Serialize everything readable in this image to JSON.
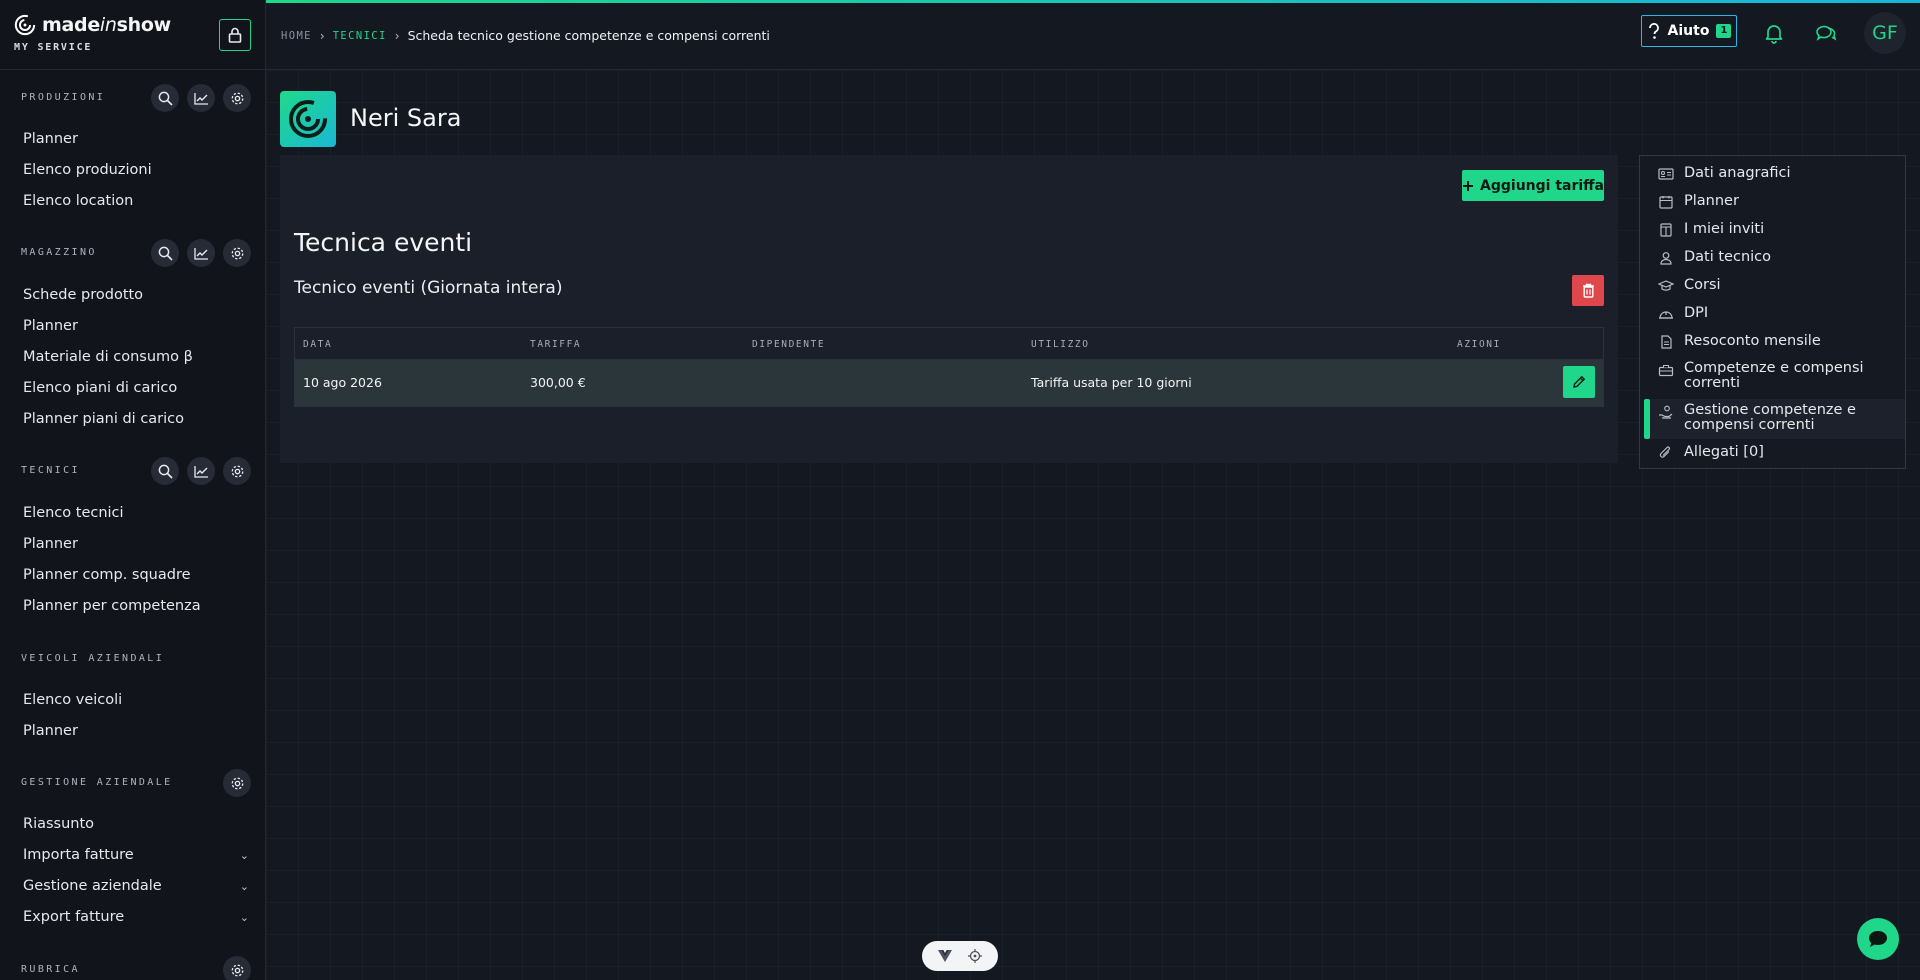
{
  "brand": {
    "name_main": "made",
    "name_italic": "in",
    "name_end": "show",
    "subtitle": "MY SERVICE"
  },
  "sidebar": {
    "sections": [
      {
        "title": "PRODUZIONI",
        "items": [
          "Planner",
          "Elenco produzioni",
          "Elenco location"
        ]
      },
      {
        "title": "MAGAZZINO",
        "items": [
          "Schede prodotto",
          "Planner",
          "Materiale di consumo β",
          "Elenco piani di carico",
          "Planner piani di carico"
        ]
      },
      {
        "title": "TECNICI",
        "items": [
          "Elenco tecnici",
          "Planner",
          "Planner comp. squadre",
          "Planner per competenza"
        ]
      },
      {
        "title": "VEICOLI AZIENDALI",
        "items": [
          "Elenco veicoli",
          "Planner"
        ]
      },
      {
        "title": "GESTIONE AZIENDALE",
        "items": [
          "Riassunto",
          "Importa fatture",
          "Gestione aziendale",
          "Export fatture"
        ]
      },
      {
        "title": "RUBRICA"
      }
    ]
  },
  "breadcrumb": {
    "home": "HOME",
    "section": "TECNICI",
    "current": "Scheda tecnico gestione competenze e compensi correnti"
  },
  "header": {
    "help_label": "Aiuto",
    "help_count": "1",
    "avatar_initials": "GF"
  },
  "profile": {
    "name": "Neri Sara"
  },
  "main": {
    "add_button": "Aggiungi tariffa",
    "section_title": "Tecnica eventi",
    "subsection_title": "Tecnico eventi (Giornata intera)",
    "table": {
      "headers": [
        "DATA",
        "TARIFFA",
        "DIPENDENTE",
        "UTILIZZO",
        "AZIONI"
      ],
      "rows": [
        {
          "data": "10 ago 2026",
          "tariffa": "300,00 €",
          "dipendente": "",
          "utilizzo": "Tariffa usata per 10 giorni"
        }
      ]
    }
  },
  "right_menu": {
    "items": [
      {
        "label": "Dati anagrafici",
        "icon": "id-card-icon"
      },
      {
        "label": "Planner",
        "icon": "calendar-icon"
      },
      {
        "label": "I miei inviti",
        "icon": "invite-icon"
      },
      {
        "label": "Dati tecnico",
        "icon": "user-icon"
      },
      {
        "label": "Corsi",
        "icon": "graduation-cap-icon"
      },
      {
        "label": "DPI",
        "icon": "helmet-icon"
      },
      {
        "label": "Resoconto mensile",
        "icon": "document-icon"
      },
      {
        "label": "Competenze e compensi correnti",
        "icon": "toolbox-icon"
      },
      {
        "label": "Gestione competenze e compensi correnti",
        "icon": "hand-money-icon"
      },
      {
        "label": "Allegati [0]",
        "icon": "paperclip-icon"
      }
    ],
    "active_index": 8
  },
  "colors": {
    "accent": "#1fd68a",
    "danger": "#e0474c",
    "help_border": "#2fb5e6",
    "background": "#141820"
  }
}
